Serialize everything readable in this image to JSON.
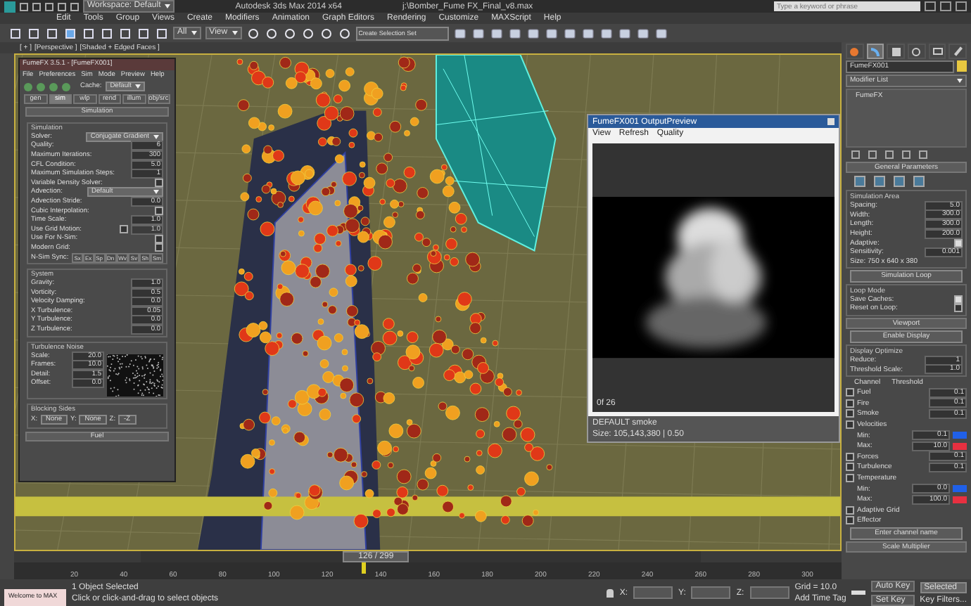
{
  "title_bar": {
    "workspace": "Workspace: Default",
    "app_title": "Autodesk 3ds Max  2014 x64",
    "file_path": "j:\\Bomber_Fume FX_Final_v8.max",
    "search": {
      "placeholder": "Type a keyword or phrase"
    }
  },
  "menu_bar": [
    "Edit",
    "Tools",
    "Group",
    "Views",
    "Create",
    "Modifiers",
    "Animation",
    "Graph Editors",
    "Rendering",
    "Customize",
    "MAXScript",
    "Help"
  ],
  "toolbar": {
    "selection_filter": "All",
    "reference_coordinate": "View",
    "named_selection": {
      "placeholder": "Create Selection Set"
    }
  },
  "viewport": {
    "labels": [
      "[ + ]",
      "[Perspective ]",
      "[Shaded + Edged Faces ]"
    ]
  },
  "fumefx_window": {
    "title": "FumeFX 3.5.1 - [FumeFX001]",
    "menus": [
      "File",
      "Preferences",
      "Sim",
      "Mode",
      "Preview",
      "Help"
    ],
    "cache_label": "Cache:",
    "cache_value": "Default",
    "tabs": [
      {
        "label": "gen",
        "selected": false
      },
      {
        "label": "sim",
        "selected": true
      },
      {
        "label": "wlp",
        "selected": false
      },
      {
        "label": "rend",
        "selected": false
      },
      {
        "label": "illum",
        "selected": false
      },
      {
        "label": "obj/src",
        "selected": false
      }
    ],
    "rollout": "Simulation",
    "groups": [
      {
        "title": "Simulation",
        "rows": [
          {
            "kind": "dropdown",
            "label": "Solver:",
            "value": "Conjugate Gradient"
          },
          {
            "kind": "number",
            "label": "Quality:",
            "value": "6"
          },
          {
            "kind": "number",
            "label": "Maximum Iterations:",
            "value": "300"
          },
          {
            "kind": "number",
            "label": "CFL Condition:",
            "value": "5.0"
          },
          {
            "kind": "number",
            "label": "Maximum Simulation Steps:",
            "value": "1"
          },
          {
            "kind": "checkbox",
            "label": "Variable Density Solver:",
            "checked": false
          },
          {
            "kind": "dropdown",
            "label": "Advection:",
            "value": "Default"
          },
          {
            "kind": "number",
            "label": "Advection Stride:",
            "value": "0.0"
          },
          {
            "kind": "checkbox",
            "label": "Cubic Interpolation:",
            "checked": false
          },
          {
            "kind": "number",
            "label": "Time Scale:",
            "value": "1.0"
          },
          {
            "kind": "checknumber",
            "label": "Use Grid Motion:",
            "checked": false,
            "value": "1.0"
          },
          {
            "kind": "checkbox",
            "label": "Use For N-Sim:",
            "checked": false
          },
          {
            "kind": "checkbox",
            "label": "Modern Grid:",
            "checked": false
          },
          {
            "kind": "buttons",
            "label": "N-Sim Sync:",
            "buttons": [
              "Sx",
              "Ex",
              "Sp",
              "Dn",
              "Wv",
              "Sv",
              "Sh",
              "Sm"
            ]
          }
        ]
      },
      {
        "title": "System",
        "rows": [
          {
            "kind": "number",
            "label": "Gravity:",
            "value": "1.0"
          },
          {
            "kind": "number",
            "label": "Vorticity:",
            "value": "0.5"
          },
          {
            "kind": "number",
            "label": "Velocity Damping:",
            "value": "0.0"
          },
          {
            "kind": "number",
            "label": "X Turbulence:",
            "value": "0.05"
          },
          {
            "kind": "number",
            "label": "Y Turbulence:",
            "value": "0.0"
          },
          {
            "kind": "number",
            "label": "Z Turbulence:",
            "value": "0.0"
          }
        ]
      },
      {
        "title": "Turbulence Noise",
        "rows": [
          {
            "kind": "number",
            "label": "Scale:",
            "value": "20.0"
          },
          {
            "kind": "number",
            "label": "Frames:",
            "value": "10.0"
          },
          {
            "kind": "number",
            "label": "Detail:",
            "value": "1.5"
          },
          {
            "kind": "number",
            "label": "Offset:",
            "value": "0.0"
          }
        ]
      }
    ],
    "blocking_sides": {
      "title": "Blocking Sides",
      "sides": [
        {
          "axis": "X:",
          "value": "None"
        },
        {
          "axis": "Y:",
          "value": "None"
        },
        {
          "axis": "Z:",
          "value": "-Z"
        }
      ]
    },
    "next_rollout": "Fuel"
  },
  "preview_window": {
    "title": "FumeFX001 OutputPreview",
    "menus": [
      "View",
      "Refresh",
      "Quality"
    ],
    "frame_label": "0f 26",
    "channel": "DEFAULT smoke",
    "size": "Size: 105,143,380 | 0.50"
  },
  "command_panel": {
    "tabs": [
      {
        "kind": "create",
        "selected": false
      },
      {
        "kind": "modify",
        "selected": true
      },
      {
        "kind": "hierarchy",
        "selected": false
      },
      {
        "kind": "motion",
        "selected": false
      },
      {
        "kind": "display",
        "selected": false
      },
      {
        "kind": "utilities",
        "selected": false
      }
    ],
    "object_name": "FumeFX001",
    "modifier_list": "Modifier List",
    "stack": [
      "FumeFX"
    ],
    "general_rollout": "General Parameters",
    "sim_area_title": "Simulation Area",
    "sim_area": [
      {
        "kind": "number",
        "label": "Spacing:",
        "value": "5.0"
      },
      {
        "kind": "number",
        "label": "Width:",
        "value": "300.0"
      },
      {
        "kind": "number",
        "label": "Length:",
        "value": "300.0"
      },
      {
        "kind": "number",
        "label": "Height:",
        "value": "200.0"
      },
      {
        "kind": "checkbox",
        "label": "Adaptive:",
        "checked": true
      },
      {
        "kind": "number",
        "label": "Sensitivity:",
        "value": "0.001"
      }
    ],
    "size_text": "Size: 750 x 640 x 380",
    "sim_loop_button": "Simulation Loop",
    "loop_mode_title": "Loop Mode",
    "loop_mode": [
      {
        "label": "Save Caches:",
        "checked": true
      },
      {
        "label": "Reset on Loop:",
        "checked": false
      }
    ],
    "viewport_rollout": "Viewport",
    "enable_display": "Enable Display",
    "display_opt_title": "Display Optimize",
    "display_opt": [
      {
        "label": "Reduce:",
        "value": "1"
      },
      {
        "label": "Threshold Scale:",
        "value": "1.0"
      }
    ],
    "channel_header": "Channel",
    "threshold_header": "Threshold",
    "channels": [
      {
        "label": "Fuel",
        "checked": false,
        "value": "0.1"
      },
      {
        "label": "Fire",
        "checked": false,
        "value": "0.1"
      },
      {
        "label": "Smoke",
        "checked": false,
        "value": "0.1"
      },
      {
        "label": "Velocities",
        "checked": false,
        "range": [
          {
            "label": "Min:",
            "value": "0.1",
            "color": "#2060e8"
          },
          {
            "label": "Max:",
            "value": "10.0",
            "color": "#e83040"
          }
        ]
      },
      {
        "label": "Forces",
        "checked": false,
        "value": "0.1"
      },
      {
        "label": "Turbulence",
        "checked": false,
        "value": "0.1"
      },
      {
        "label": "Temperature",
        "checked": false,
        "range": [
          {
            "label": "Min:",
            "value": "0.0",
            "color": "#2060e8"
          },
          {
            "label": "Max:",
            "value": "100.0",
            "color": "#e83040"
          }
        ]
      },
      {
        "label": "Adaptive Grid",
        "checked": false
      },
      {
        "label": "Effector",
        "checked": false
      }
    ],
    "channel_name_button": "Enter channel name",
    "scale_rollout": "Scale Multiplier"
  },
  "timeline": {
    "slider_label": "126 / 299",
    "level": 0.42,
    "ticks": [
      "20",
      "40",
      "60",
      "80",
      "100",
      "120",
      "140",
      "160",
      "180",
      "200",
      "220",
      "240",
      "260",
      "280",
      "300"
    ]
  },
  "status_bar": {
    "welcome": "Welcome to MAX",
    "selection": "1 Object Selected",
    "prompt": "Click or click-and-drag to select objects",
    "coords": [
      "X:",
      "Y:",
      "Z:"
    ],
    "grid": "Grid = 10.0",
    "add_time_tag": "Add Time Tag",
    "auto_key": "Auto Key",
    "key_mode": "Selected",
    "set_key": "Set Key",
    "key_filters": "Key Filters..."
  }
}
